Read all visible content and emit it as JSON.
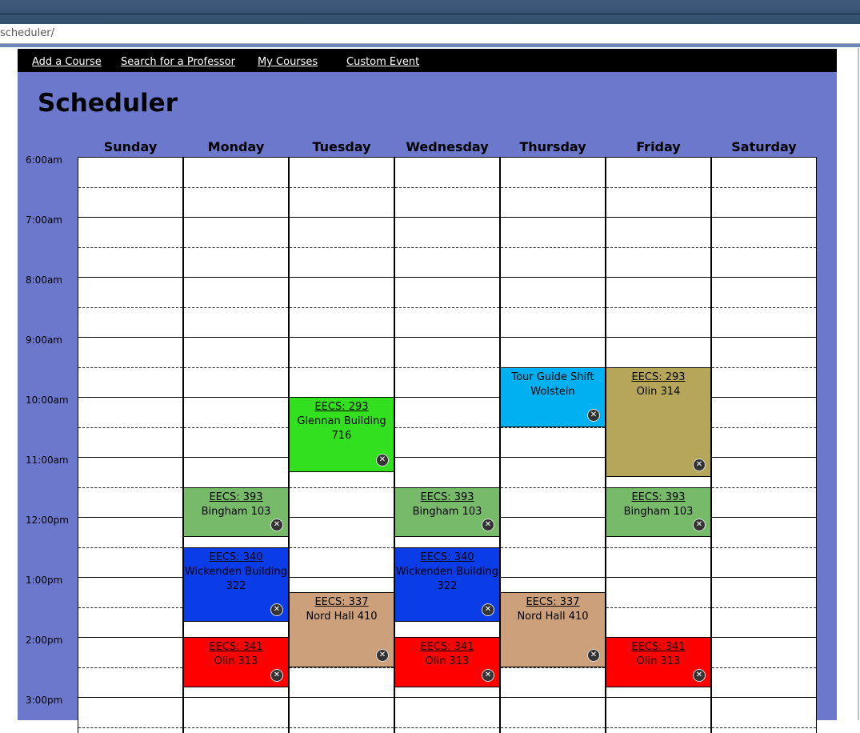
{
  "browser": {
    "url": "scheduler/"
  },
  "nav": {
    "add_course": "Add a Course",
    "search_professor": "Search for a Professor",
    "my_courses": "My Courses",
    "custom_event": "Custom Event"
  },
  "title": "Scheduler",
  "days": [
    "Sunday",
    "Monday",
    "Tuesday",
    "Wednesday",
    "Thursday",
    "Friday",
    "Saturday"
  ],
  "times": [
    "6:00am",
    "7:00am",
    "8:00am",
    "9:00am",
    "10:00am",
    "11:00am",
    "12:00pm",
    "1:00pm",
    "2:00pm",
    "3:00pm"
  ],
  "close_icon": "x-circle-icon",
  "events": [
    {
      "day": "Tuesday",
      "start": "10:00am",
      "end": "11:15am",
      "code": "EECS: 293",
      "location": "Glennan Building 716",
      "color": "#33e020"
    },
    {
      "day": "Thursday",
      "start": "9:30am",
      "end": "10:30am",
      "code": "",
      "title": "Tour Guide Shift",
      "location": "Wolstein",
      "color": "#00b0f0"
    },
    {
      "day": "Friday",
      "start": "9:30am",
      "end": "11:20am",
      "code": "EECS: 293",
      "location": "Olin 314",
      "color": "#b5a65a"
    },
    {
      "day": "Monday",
      "start": "11:30am",
      "end": "12:20pm",
      "code": "EECS: 393",
      "location": "Bingham 103",
      "color": "#77bb6a"
    },
    {
      "day": "Wednesday",
      "start": "11:30am",
      "end": "12:20pm",
      "code": "EECS: 393",
      "location": "Bingham 103",
      "color": "#77bb6a"
    },
    {
      "day": "Friday",
      "start": "11:30am",
      "end": "12:20pm",
      "code": "EECS: 393",
      "location": "Bingham 103",
      "color": "#77bb6a"
    },
    {
      "day": "Monday",
      "start": "12:30pm",
      "end": "1:45pm",
      "code": "EECS: 340",
      "location": "Wickenden Building 322",
      "color": "#0a3de8"
    },
    {
      "day": "Wednesday",
      "start": "12:30pm",
      "end": "1:45pm",
      "code": "EECS: 340",
      "location": "Wickenden Building 322",
      "color": "#0a3de8"
    },
    {
      "day": "Tuesday",
      "start": "1:15pm",
      "end": "2:30pm",
      "code": "EECS: 337",
      "location": "Nord Hall 410",
      "color": "#cba07a"
    },
    {
      "day": "Thursday",
      "start": "1:15pm",
      "end": "2:30pm",
      "code": "EECS: 337",
      "location": "Nord Hall 410",
      "color": "#cba07a"
    },
    {
      "day": "Monday",
      "start": "2:00pm",
      "end": "2:50pm",
      "code": "EECS: 341",
      "location": "Olin 313",
      "color": "#ff0000"
    },
    {
      "day": "Wednesday",
      "start": "2:00pm",
      "end": "2:50pm",
      "code": "EECS: 341",
      "location": "Olin 313",
      "color": "#ff0000"
    },
    {
      "day": "Friday",
      "start": "2:00pm",
      "end": "2:50pm",
      "code": "EECS: 341",
      "location": "Olin 313",
      "color": "#ff0000"
    }
  ]
}
